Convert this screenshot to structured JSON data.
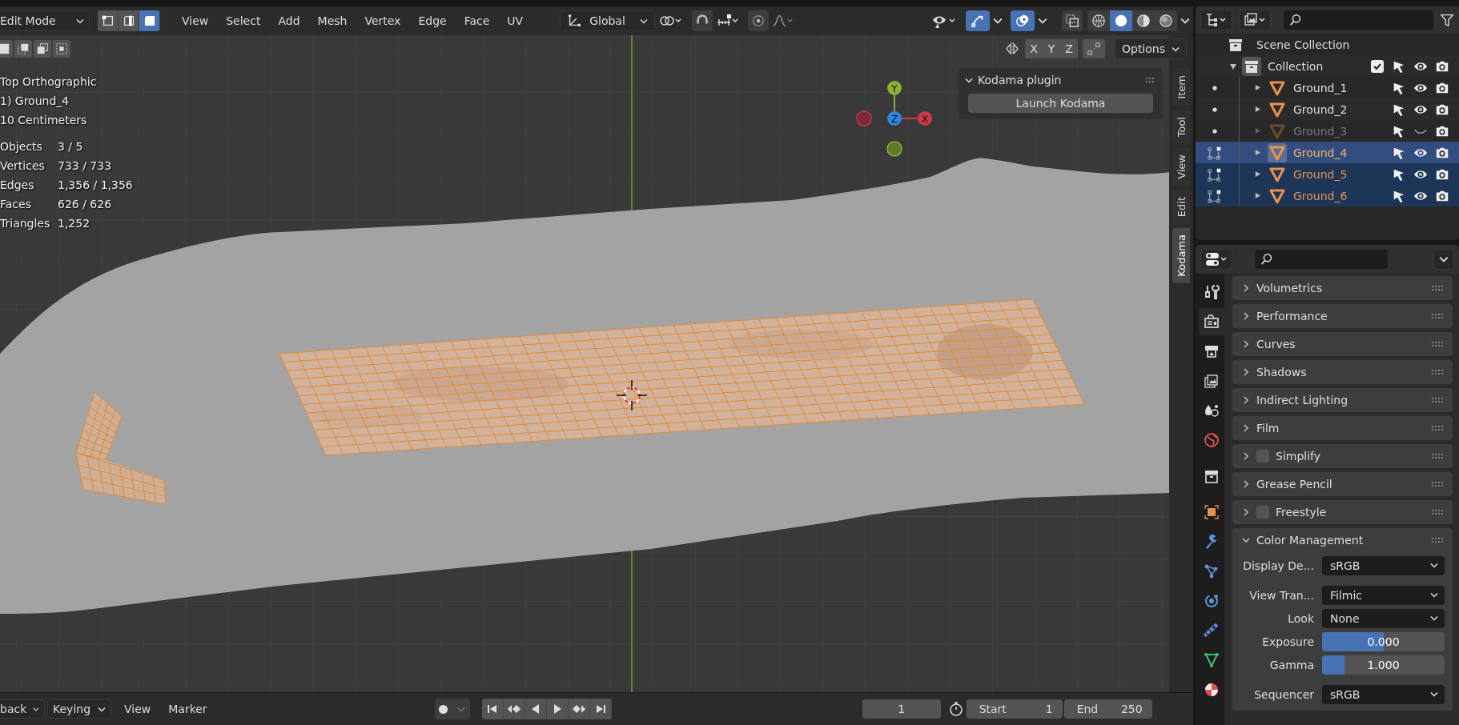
{
  "viewport_header": {
    "mode": "Edit Mode",
    "select_modes": [
      {
        "kind": "vertex",
        "selected": false
      },
      {
        "kind": "edge",
        "selected": false
      },
      {
        "kind": "face",
        "selected": true
      }
    ],
    "menus": [
      "View",
      "Select",
      "Add",
      "Mesh",
      "Vertex",
      "Edge",
      "Face",
      "UV"
    ],
    "orientation": "Global"
  },
  "viewport_tools": {
    "axes": [
      "X",
      "Y",
      "Z"
    ],
    "options": "Options"
  },
  "overlay_info": {
    "lines": [
      "Top Orthographic",
      "1) Ground_4",
      "10 Centimeters"
    ],
    "stats": [
      {
        "label": "Objects",
        "value": "3 / 5"
      },
      {
        "label": "Vertices",
        "value": "733 / 733"
      },
      {
        "label": "Edges",
        "value": "1,356 / 1,356"
      },
      {
        "label": "Faces",
        "value": "626 / 626"
      },
      {
        "label": "Triangles",
        "value": "1,252"
      }
    ]
  },
  "gizmo": {
    "x": "X",
    "y": "Y",
    "z": "Z"
  },
  "kodama_panel": {
    "title": "Kodama plugin",
    "expanded": true,
    "button": "Launch Kodama"
  },
  "sidebar_tabs": [
    {
      "label": "Item",
      "selected": false
    },
    {
      "label": "Tool",
      "selected": false
    },
    {
      "label": "View",
      "selected": false
    },
    {
      "label": "Edit",
      "selected": false
    },
    {
      "label": "Kodama",
      "selected": true
    }
  ],
  "timeline": {
    "playback": "back",
    "keying": "Keying",
    "menus": [
      "View",
      "Marker"
    ],
    "current_frame": "1",
    "start_label": "Start",
    "start": "1",
    "end_label": "End",
    "end": "250"
  },
  "outliner": {
    "root": "Scene Collection",
    "collection": {
      "name": "Collection",
      "expanded": true,
      "checked": true,
      "children": [
        {
          "name": "Ground_1",
          "selected": false,
          "active": false,
          "hidden": false,
          "editing": false
        },
        {
          "name": "Ground_2",
          "selected": false,
          "active": false,
          "hidden": false,
          "editing": false
        },
        {
          "name": "Ground_3",
          "selected": false,
          "active": false,
          "hidden": true,
          "editing": false
        },
        {
          "name": "Ground_4",
          "selected": true,
          "active": true,
          "hidden": false,
          "editing": true
        },
        {
          "name": "Ground_5",
          "selected": true,
          "active": false,
          "hidden": false,
          "editing": true
        },
        {
          "name": "Ground_6",
          "selected": true,
          "active": false,
          "hidden": false,
          "editing": true
        }
      ]
    }
  },
  "properties": {
    "tabs": [
      {
        "kind": "tool",
        "selected": false
      },
      {
        "kind": "render",
        "selected": true
      },
      {
        "kind": "output",
        "selected": false
      },
      {
        "kind": "view_layer",
        "selected": false
      },
      {
        "kind": "scene",
        "selected": false
      },
      {
        "kind": "world",
        "selected": false
      },
      {
        "kind": "collection",
        "selected": false
      },
      {
        "kind": "object",
        "selected": false
      },
      {
        "kind": "modifier",
        "selected": false
      },
      {
        "kind": "particles",
        "selected": false
      },
      {
        "kind": "physics",
        "selected": false
      },
      {
        "kind": "constraints",
        "selected": false
      },
      {
        "kind": "data",
        "selected": false
      },
      {
        "kind": "material",
        "selected": false
      }
    ],
    "panels": [
      {
        "title": "Volumetrics",
        "kind": "plain",
        "expanded": false
      },
      {
        "title": "Performance",
        "kind": "plain",
        "expanded": false
      },
      {
        "title": "Curves",
        "kind": "plain",
        "expanded": false
      },
      {
        "title": "Shadows",
        "kind": "plain",
        "expanded": false
      },
      {
        "title": "Indirect Lighting",
        "kind": "plain",
        "expanded": false
      },
      {
        "title": "Film",
        "kind": "plain",
        "expanded": false
      },
      {
        "title": "Simplify",
        "kind": "checkbox",
        "checked": false,
        "expanded": false
      },
      {
        "title": "Grease Pencil",
        "kind": "plain",
        "expanded": false
      },
      {
        "title": "Freestyle",
        "kind": "checkbox",
        "checked": false,
        "expanded": false
      },
      {
        "title": "Color Management",
        "kind": "plain",
        "expanded": true,
        "fields": [
          {
            "label": "Display De...",
            "kind": "dropdown",
            "value": "sRGB"
          },
          {
            "label": "View Tran...",
            "kind": "dropdown",
            "value": "Filmic"
          },
          {
            "label": "Look",
            "kind": "dropdown",
            "value": "None"
          },
          {
            "label": "Exposure",
            "kind": "slider",
            "value": "0.000",
            "level": 0.5
          },
          {
            "label": "Gamma",
            "kind": "slider",
            "value": "1.000",
            "level": 0.18
          },
          {
            "label": "Sequencer",
            "kind": "dropdown",
            "value": "sRGB"
          }
        ]
      }
    ]
  }
}
